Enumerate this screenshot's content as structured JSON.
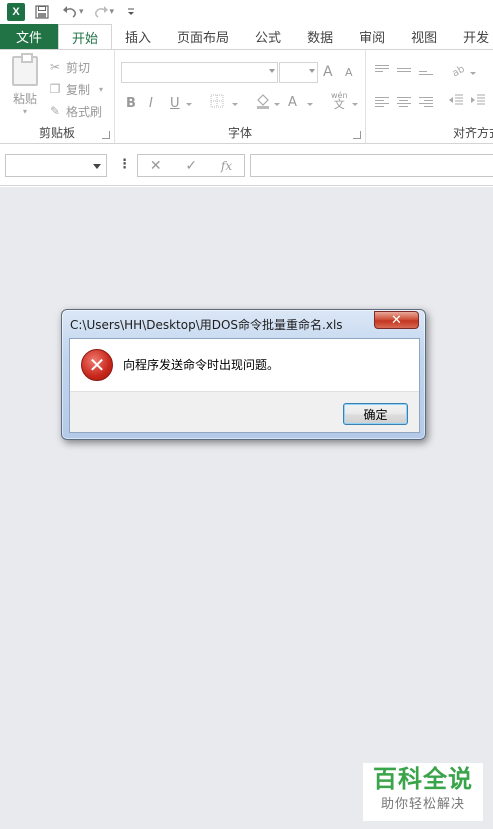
{
  "quick_access": {
    "app_icon_letter": "X",
    "save_icon": "floppy-icon",
    "undo_icon": "undo-icon",
    "redo_icon": "redo-icon",
    "customize_icon": "customize-icon"
  },
  "tabs": [
    {
      "label": "文件"
    },
    {
      "label": "开始"
    },
    {
      "label": "插入"
    },
    {
      "label": "页面布局"
    },
    {
      "label": "公式"
    },
    {
      "label": "数据"
    },
    {
      "label": "审阅"
    },
    {
      "label": "视图"
    },
    {
      "label": "开发"
    }
  ],
  "ribbon": {
    "clipboard": {
      "paste_label": "粘贴",
      "cut_label": "剪切",
      "copy_label": "复制",
      "format_painter_label": "格式刷",
      "group_label": "剪贴板"
    },
    "font": {
      "bold": "B",
      "italic": "I",
      "underline": "U",
      "grow_font": "A",
      "shrink_font": "A",
      "font_color": "A",
      "phonetic": "wén",
      "phonetic_char": "文",
      "group_label": "字体"
    },
    "alignment": {
      "group_label": "对齐方式"
    }
  },
  "formula_bar": {
    "name_box_value": "",
    "dots": "⋮",
    "cancel_icon": "✕",
    "enter_icon": "✓",
    "fx_label": "fx",
    "formula_value": ""
  },
  "dialog": {
    "title": "C:\\Users\\HH\\Desktop\\用DOS命令批量重命名.xls",
    "close_glyph": "✕",
    "error_glyph": "✕",
    "message": "向程序发送命令时出现问题。",
    "ok_label": "确定"
  },
  "watermark": {
    "main": "百科全说",
    "sub": "助你轻松解决"
  },
  "colors": {
    "excel_green": "#217346",
    "workspace": "#e9eaee",
    "error_red": "#c8261a"
  }
}
